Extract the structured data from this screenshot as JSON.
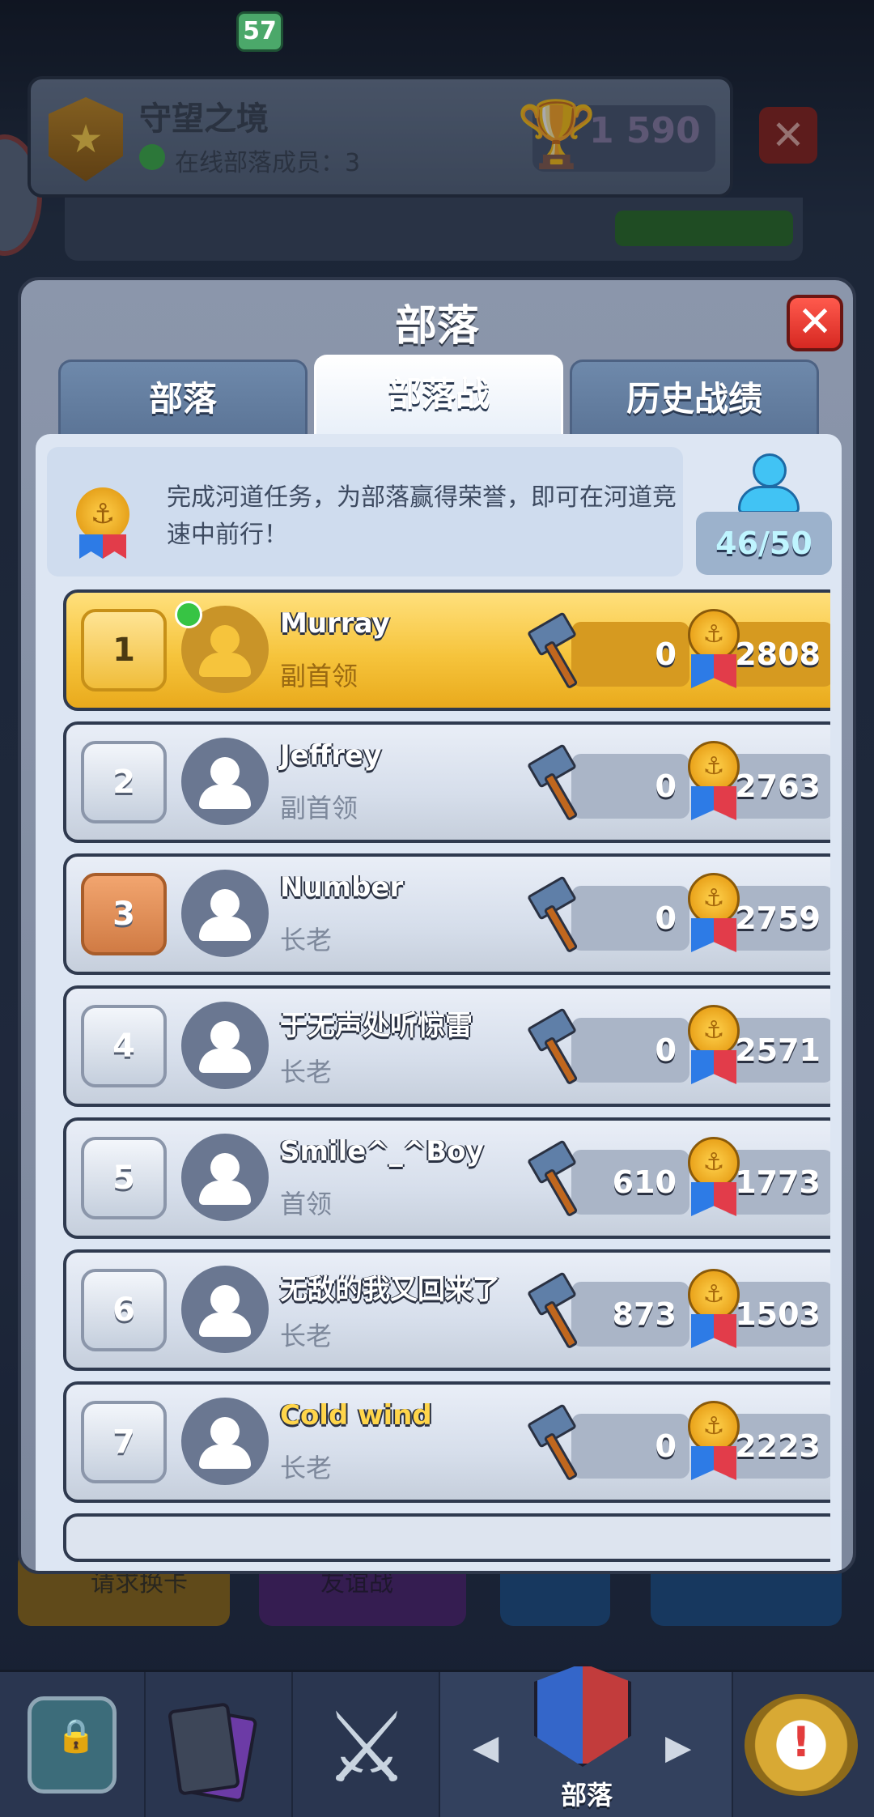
{
  "background": {
    "clan_header": {
      "name": "守望之境",
      "online_label": "在线部落成员：3",
      "trophies": "1 590"
    },
    "bottom_buttons": [
      "请求换卡",
      "友谊战",
      "",
      ""
    ]
  },
  "modal": {
    "title": "部落",
    "tabs": [
      {
        "label": "部落",
        "active": false
      },
      {
        "label": "部落战",
        "active": true
      },
      {
        "label": "历史战绩",
        "active": false
      }
    ],
    "info_text": "完成河道任务，为部落赢得荣誉，即可在河道竞速中前行！",
    "members": "46/50",
    "members_rows": [
      {
        "rank": "1",
        "name": "Murray",
        "role": "副首领",
        "hammer": "0",
        "medals": "2808",
        "style": "gold",
        "online": true
      },
      {
        "rank": "2",
        "name": "Jeffrey",
        "role": "副首领",
        "hammer": "0",
        "medals": "2763",
        "style": "normal",
        "online": false
      },
      {
        "rank": "3",
        "name": "Number",
        "role": "长老",
        "hammer": "0",
        "medals": "2759",
        "style": "bronze",
        "online": false
      },
      {
        "rank": "4",
        "name": "于无声处听惊雷",
        "role": "长老",
        "hammer": "0",
        "medals": "2571",
        "style": "normal",
        "online": false
      },
      {
        "rank": "5",
        "name": "Smile^_^Boy",
        "role": "首领",
        "hammer": "610",
        "medals": "1773",
        "style": "normal",
        "online": false
      },
      {
        "rank": "6",
        "name": "无敌的我又回来了",
        "role": "长老",
        "hammer": "873",
        "medals": "1503",
        "style": "normal",
        "online": false
      },
      {
        "rank": "7",
        "name": "Cold wind",
        "role": "长老",
        "hammer": "0",
        "medals": "2223",
        "style": "gold-name",
        "online": false
      }
    ]
  },
  "nav": {
    "cards_badge": "57",
    "active_label": "部落",
    "icons": [
      "chest-icon",
      "cards-icon",
      "battle-icon",
      "clan-icon",
      "events-icon"
    ]
  },
  "colors": {
    "gold_row": "#f6c43c",
    "close_red": "#e0322a",
    "tab_blue": "#5a7395"
  }
}
